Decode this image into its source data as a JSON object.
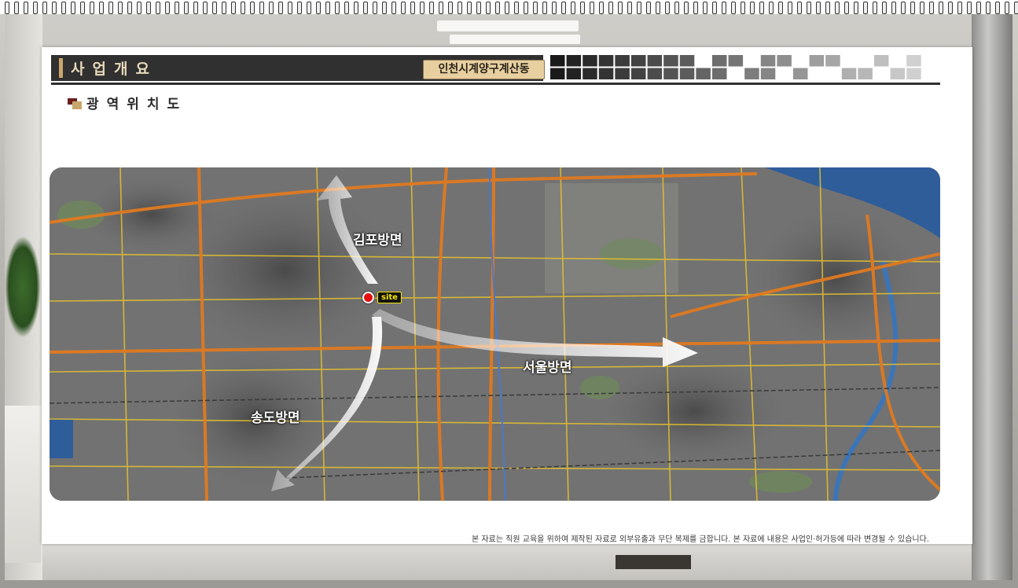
{
  "header": {
    "title": "사업개요",
    "location": "인천시계양구계산동"
  },
  "section": {
    "title": "광역위치도"
  },
  "map": {
    "site_label": "site",
    "directions": {
      "gimpo": "김포방면",
      "seoul": "서울방면",
      "songdo": "송도방면"
    }
  },
  "footer": {
    "disclaimer": "본 자료는 직원 교육을 위하여 제작된 자료로 외부유출과 무단 복제를 금합니다.  본 자료에 내용은 사업인·허가등에 따라 변경될 수 있습니다."
  },
  "colors": {
    "header_bg": "#303030",
    "accent": "#c9a66b",
    "tag_bg": "#e7cfa0",
    "road_orange": "#e07a20",
    "road_yellow": "#e6c22e",
    "river": "#2f5d9a",
    "site_red": "#e41010"
  },
  "icons": [
    "section-square-icon",
    "site-pin-icon",
    "direction-arrow-icon"
  ]
}
